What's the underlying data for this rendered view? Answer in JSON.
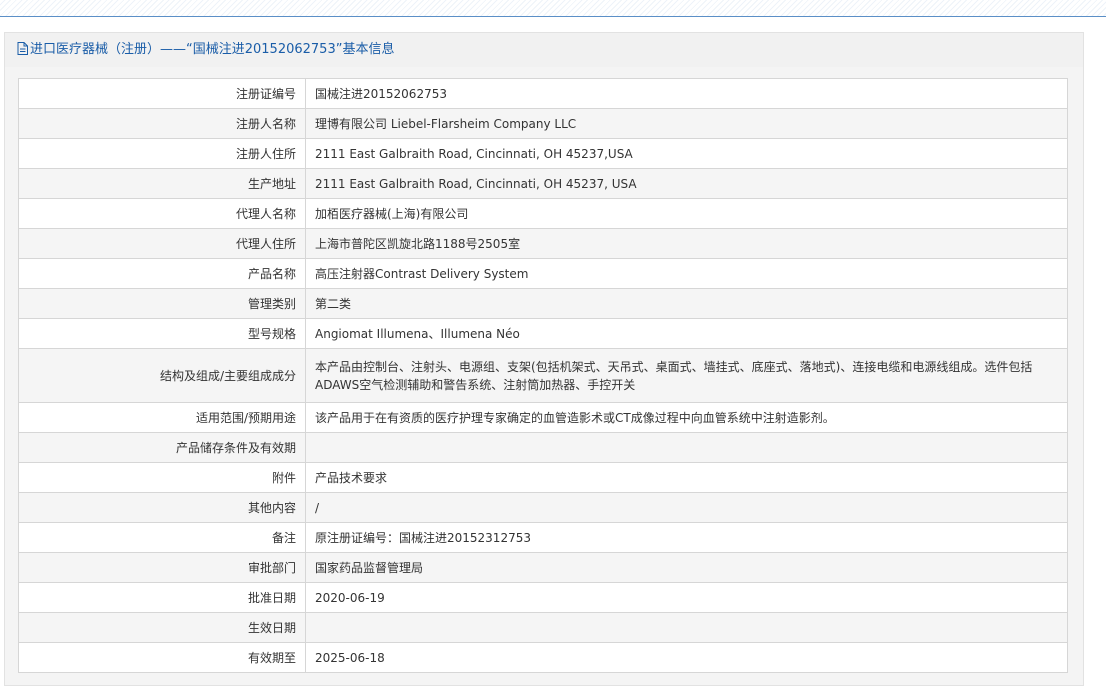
{
  "header": {
    "title": "进口医疗器械（注册）——“国械注进20152062753”基本信息",
    "icon": "document-icon"
  },
  "rows": [
    {
      "label": "注册证编号",
      "value": "国械注进20152062753"
    },
    {
      "label": "注册人名称",
      "value": "理博有限公司 Liebel-Flarsheim Company LLC"
    },
    {
      "label": "注册人住所",
      "value": "2111 East Galbraith Road, Cincinnati, OH 45237,USA"
    },
    {
      "label": "生产地址",
      "value": "2111 East Galbraith Road, Cincinnati, OH 45237, USA"
    },
    {
      "label": "代理人名称",
      "value": "加栢医疗器械(上海)有限公司"
    },
    {
      "label": "代理人住所",
      "value": "上海市普陀区凯旋北路1188号2505室"
    },
    {
      "label": "产品名称",
      "value": "高压注射器Contrast Delivery System"
    },
    {
      "label": "管理类别",
      "value": "第二类"
    },
    {
      "label": "型号规格",
      "value": "Angiomat Illumena、Illumena Néo"
    },
    {
      "label": "结构及组成/主要组成成分",
      "value": "本产品由控制台、注射头、电源组、支架(包括机架式、天吊式、桌面式、墙挂式、底座式、落地式)、连接电缆和电源线组成。选件包括ADAWS空气检测辅助和警告系统、注射筒加热器、手控开关"
    },
    {
      "label": "适用范围/预期用途",
      "value": "该产品用于在有资质的医疗护理专家确定的血管造影术或CT成像过程中向血管系统中注射造影剂。"
    },
    {
      "label": "产品储存条件及有效期",
      "value": ""
    },
    {
      "label": "附件",
      "value": "产品技术要求"
    },
    {
      "label": "其他内容",
      "value": "/"
    },
    {
      "label": "备注",
      "value": "原注册证编号：国械注进20152312753"
    },
    {
      "label": "审批部门",
      "value": "国家药品监督管理局"
    },
    {
      "label": "批准日期",
      "value": "2020-06-19"
    },
    {
      "label": "生效日期",
      "value": ""
    },
    {
      "label": "有效期至",
      "value": "2025-06-18"
    }
  ],
  "colors": {
    "header_text": "#1a5da8",
    "row_alt": "#f5f5f5",
    "border": "#d6d6d6"
  }
}
